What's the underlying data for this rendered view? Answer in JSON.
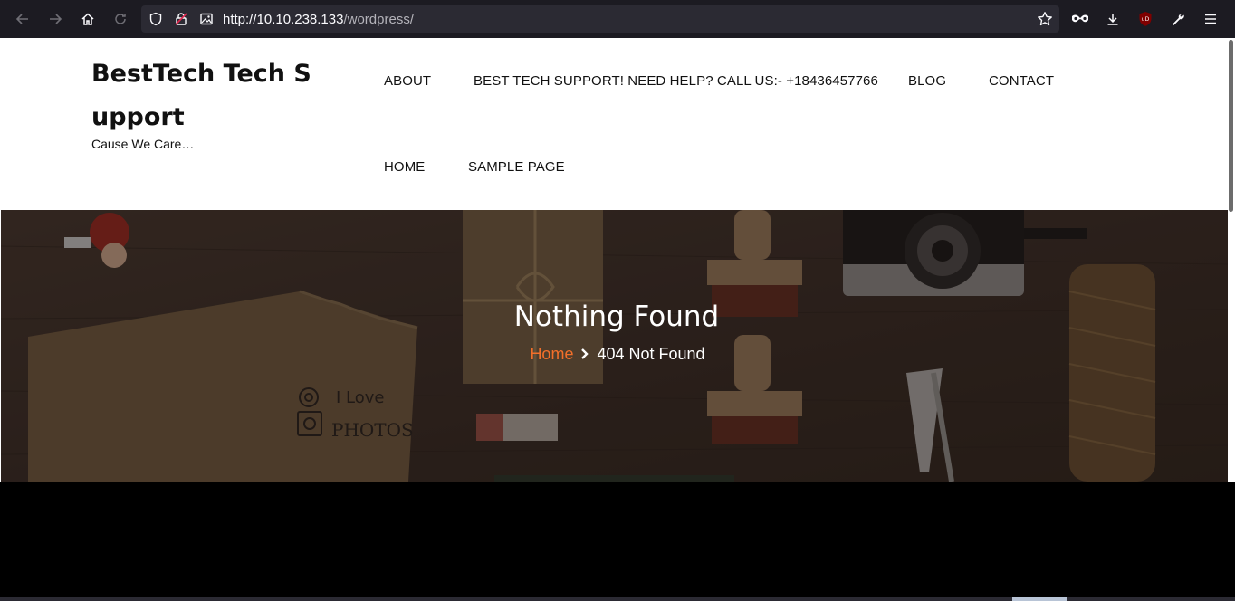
{
  "browser": {
    "url_host": "http://10.10.238.133",
    "url_path": "/wordpress/",
    "icons": [
      "back-icon",
      "forward-icon",
      "home-icon",
      "reload-icon",
      "shield-icon",
      "lock-icon",
      "image-icon",
      "bookmark-star-icon",
      "mask-icon",
      "download-icon",
      "ublock-icon",
      "wrench-icon",
      "menu-icon"
    ],
    "ublock_badge": "uD"
  },
  "site": {
    "title": "BestTech Tech Support",
    "tagline": "Cause We Care…",
    "nav": {
      "about": "About",
      "support": "Best Tech Support! Need Help? Call Us:- +18436457766",
      "blog": "Blog",
      "contact": "Contact",
      "home": "Home",
      "sample": "Sample Page"
    }
  },
  "hero": {
    "title": "Nothing Found",
    "breadcrumb_home": "Home",
    "breadcrumb_current": "404 Not Found",
    "photo_text_1": "I Love",
    "photo_text_2": "PHOTOS"
  },
  "colors": {
    "accent": "#f26f2a",
    "chrome": "#1c1b22",
    "urlbar": "#2b2a33"
  }
}
